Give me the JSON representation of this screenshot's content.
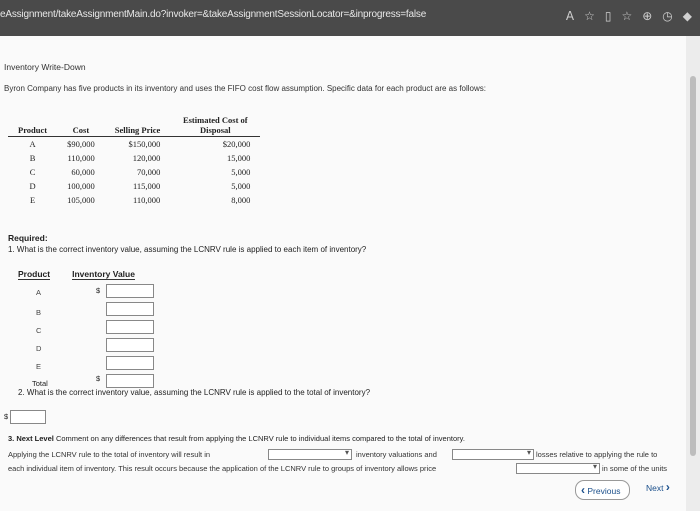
{
  "browser": {
    "url": "eAssignment/takeAssignmentMain.do?invoker=&takeAssignmentSessionLocator=&inprogress=false",
    "icons": [
      "read-aloud-icon",
      "favorite-icon",
      "split-screen-icon",
      "favorites-bar-icon",
      "extension-icon",
      "history-icon",
      "copilot-icon"
    ]
  },
  "content": {
    "section_title": "Inventory Write-Down",
    "intro": "Byron Company has five products in its inventory and uses the FIFO cost flow assumption. Specific data for each product are as follows:",
    "table": {
      "headers": [
        "Product",
        "Cost",
        "Selling Price",
        "Estimated Cost of Disposal"
      ],
      "rows": [
        [
          "A",
          "$90,000",
          "$150,000",
          "$20,000"
        ],
        [
          "B",
          "110,000",
          "120,000",
          "15,000"
        ],
        [
          "C",
          "60,000",
          "70,000",
          "5,000"
        ],
        [
          "D",
          "100,000",
          "115,000",
          "5,000"
        ],
        [
          "E",
          "105,000",
          "110,000",
          "8,000"
        ]
      ]
    },
    "required_label": "Required:",
    "q1": "1. What is the correct inventory value, assuming the LCNRV rule is applied to each item of inventory?",
    "q1_headers": [
      "Product",
      "Inventory Value"
    ],
    "q1_rows": [
      "A",
      "B",
      "C",
      "D",
      "E"
    ],
    "total_label": "Total",
    "currency": "$",
    "q2": "2. What is the correct inventory value, assuming the LCNRV rule is applied to the total of inventory?",
    "q3_title": "3. Next Level",
    "q3_intro": "Comment on any differences that result from applying the LCNRV rule to individual items compared to the total of inventory.",
    "q3_line1_a": "Applying the LCNRV rule to the total of inventory will result in",
    "q3_line1_b": "inventory valuations and",
    "q3_line1_c": "losses relative to applying the rule to",
    "q3_line2_a": "each individual item of inventory. This result occurs because the application of the LCNRV rule to groups of inventory allows price",
    "q3_line2_b": "in some of the units",
    "nav": {
      "previous": "Previous",
      "next": "Next"
    }
  }
}
